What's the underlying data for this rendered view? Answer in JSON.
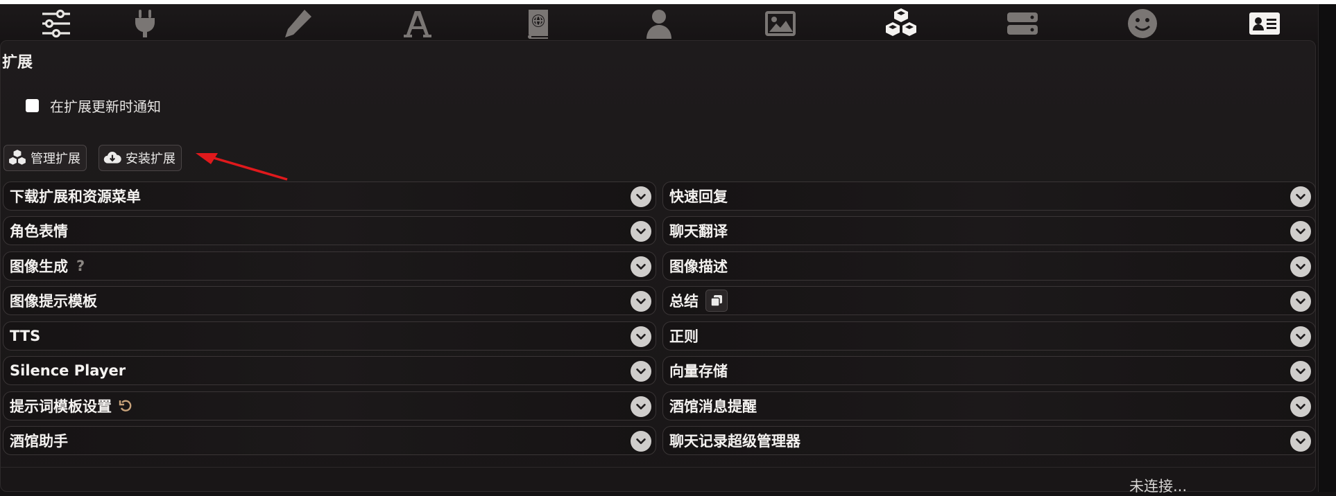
{
  "top_nav": [
    {
      "name": "sliders-icon"
    },
    {
      "name": "plug-icon"
    },
    {
      "name": "pencil-icon"
    },
    {
      "name": "font-icon"
    },
    {
      "name": "book-globe-icon"
    },
    {
      "name": "user-icon"
    },
    {
      "name": "image-icon"
    },
    {
      "name": "cubes-icon"
    },
    {
      "name": "server-icon"
    },
    {
      "name": "smile-icon"
    },
    {
      "name": "id-card-icon"
    }
  ],
  "panel": {
    "title": "扩展",
    "notify_label": "在扩展更新时通知",
    "notify_checked": false
  },
  "buttons": {
    "manage": "管理扩展",
    "install": "安装扩展"
  },
  "drawers_left": [
    {
      "label": "下载扩展和资源菜单"
    },
    {
      "label": "角色表情"
    },
    {
      "label": "图像生成",
      "extra": "?"
    },
    {
      "label": "图像提示模板"
    },
    {
      "label": "TTS"
    },
    {
      "label": "Silence Player"
    },
    {
      "label": "提示词模板设置"
    },
    {
      "label": "酒馆助手"
    }
  ],
  "drawers_right": [
    {
      "label": "快速回复"
    },
    {
      "label": "聊天翻译"
    },
    {
      "label": "图像描述"
    },
    {
      "label": "总结"
    },
    {
      "label": "正则"
    },
    {
      "label": "向量存储"
    },
    {
      "label": "酒馆消息提醒"
    },
    {
      "label": "聊天记录超级管理器"
    }
  ],
  "status": "未连接...",
  "colors": {
    "accent_arrow": "#e0191c",
    "panel_bg": "#1d1a1b",
    "icon": "#e8e6e3"
  }
}
